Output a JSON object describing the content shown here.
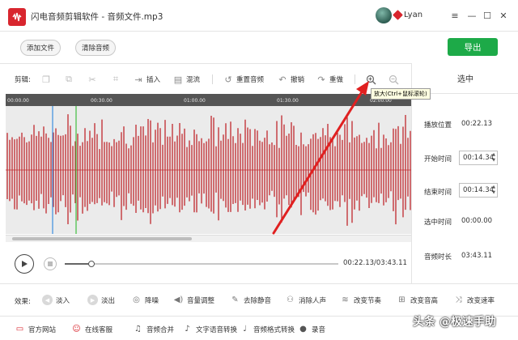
{
  "window": {
    "title": "闪电音频剪辑软件 - 音频文件.mp3",
    "username": "Lyan",
    "controls": [
      "≡",
      "—",
      "☐",
      "✕"
    ]
  },
  "actions": {
    "add_file": "添加文件",
    "clear_audio": "清除音频",
    "export": "导出"
  },
  "toolbar": {
    "label": "剪辑:",
    "insert": "插入",
    "mix": "混流",
    "reset_audio": "重置音频",
    "undo": "撤销",
    "redo": "重做",
    "zoom_tooltip": "放大(Ctrl+鼠标滚轮)"
  },
  "timeline": {
    "ticks": [
      "00:00.00",
      "00:30.00",
      "01:00.00",
      "01:30.00",
      "02:00.00"
    ]
  },
  "right_panel": {
    "header": "选中",
    "play_position_label": "播放位置",
    "play_position_value": "00:22.13",
    "start_time_label": "开始时间",
    "start_time_value": "00:14.34",
    "end_time_label": "结束时间",
    "end_time_value": "00:14.34",
    "selected_time_label": "选中时间",
    "selected_time_value": "00:00.00",
    "duration_label": "音频时长",
    "duration_value": "03:43.11"
  },
  "playback": {
    "time_readout": "00:22.13/03:43.11",
    "progress": 0.099
  },
  "effects": {
    "label": "效果:",
    "items": [
      "淡入",
      "淡出",
      "降噪",
      "音量调整",
      "去除静音",
      "消除人声",
      "改变节奏",
      "改变音高",
      "改变速率"
    ]
  },
  "bottom": {
    "items": [
      "官方网站",
      "在线客服",
      "音频合并",
      "文字语音转换",
      "音频格式转换",
      "录音"
    ]
  },
  "watermark": "头条 @极速手助",
  "colors": {
    "brand_red": "#d8262e",
    "export_green": "#1daa48",
    "waveform": "#c0282d",
    "cursor_blue": "#3b8ede",
    "cursor_green": "#3fbf3f"
  }
}
